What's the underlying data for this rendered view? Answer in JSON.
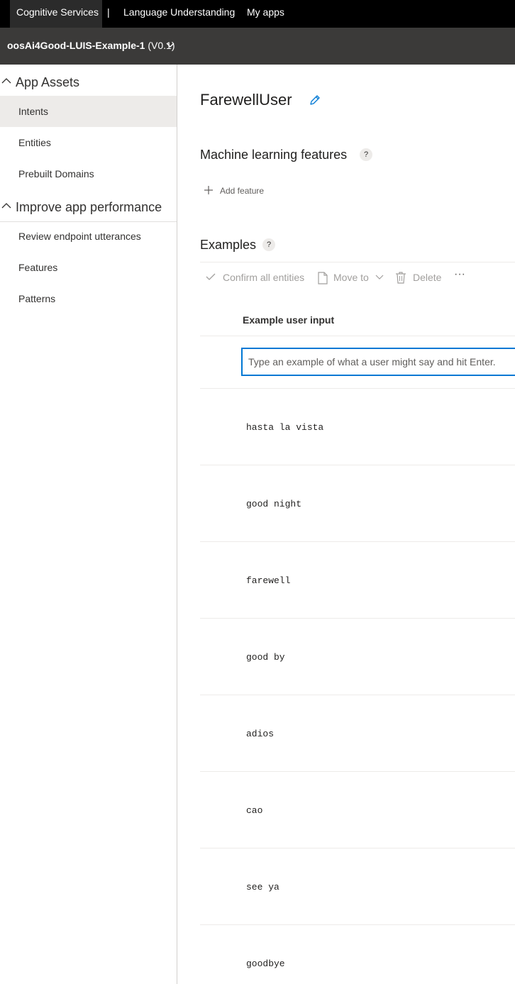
{
  "topnav": {
    "brand": "Cognitive Services",
    "separator": "|",
    "language_understanding": "Language Understanding",
    "my_apps": "My apps"
  },
  "appbar": {
    "app_name": "oosAi4Good-LUIS-Example-1",
    "version": " (V0.1)"
  },
  "sidebar": {
    "groups": [
      {
        "label": "App Assets",
        "items": [
          {
            "label": "Intents",
            "active": true
          },
          {
            "label": "Entities"
          },
          {
            "label": "Prebuilt Domains"
          }
        ]
      },
      {
        "label": "Improve app performance",
        "items": [
          {
            "label": "Review endpoint utterances"
          },
          {
            "label": "Features"
          },
          {
            "label": "Patterns"
          }
        ]
      }
    ]
  },
  "main": {
    "intent_name": "FarewellUser",
    "ml_features_title": "Machine learning features",
    "help_glyph": "?",
    "add_feature": "Add feature",
    "examples_title": "Examples",
    "commands": {
      "confirm_all": "Confirm all entities",
      "move_to": "Move to",
      "delete": "Delete",
      "more": "···"
    },
    "column_header": "Example user input",
    "input_placeholder": "Type an example of what a user might say and hit Enter.",
    "utterances": [
      "hasta la vista",
      "good night",
      "farewell",
      "good by",
      "adios",
      "cao",
      "see ya",
      "goodbye"
    ]
  },
  "colors": {
    "accent": "#0078d4",
    "topnav_bg": "#000000",
    "appbar_bg": "#3b3a39",
    "active_item_bg": "#edebe9"
  }
}
